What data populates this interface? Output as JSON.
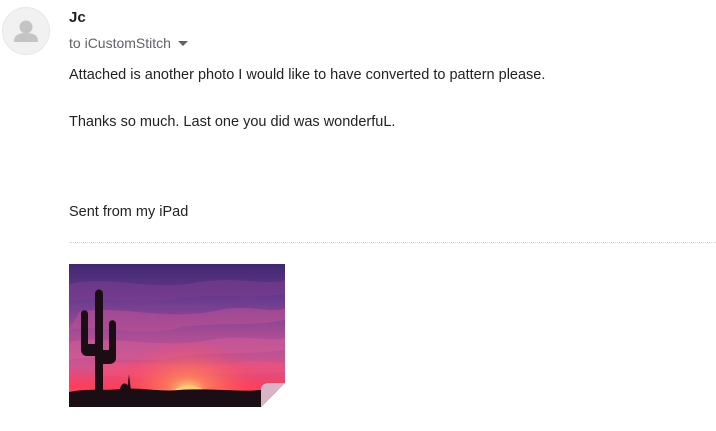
{
  "sender": {
    "name": "Jc",
    "to_prefix": "to",
    "to_name": "iCustomStitch"
  },
  "message": {
    "lines": [
      "Attached is another photo I would like to have converted to pattern please.",
      "Thanks so much. Last one you did was wonderfuL.",
      "Sent from my iPad"
    ]
  },
  "attachment": {
    "kind": "image",
    "subject": "saguaro cactus silhouette at sunset",
    "icon": "folded-corner-icon"
  },
  "colors": {
    "sky_top": "#4a2a7a",
    "sky_mid": "#b0508a",
    "horizon_glow": "#ff3d5a",
    "sun": "#ffd16a",
    "silhouette": "#1a0e14",
    "avatar_bg": "#f1f1f1",
    "avatar_icon": "#c4c4c4"
  }
}
